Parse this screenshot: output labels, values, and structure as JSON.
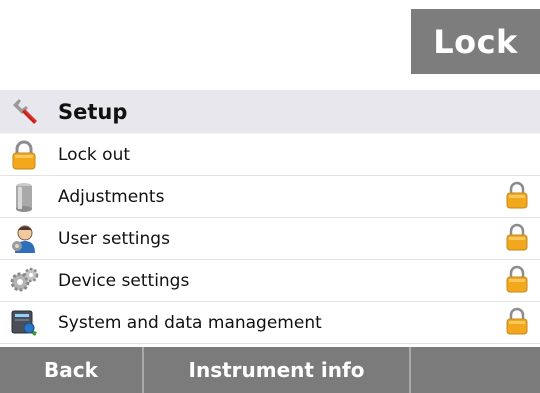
{
  "top": {
    "lock_label": "Lock"
  },
  "menu": {
    "title": "Setup",
    "title_icon": "wrench-icon",
    "items": [
      {
        "label": "Lock out",
        "icon": "padlock-icon",
        "locked": false
      },
      {
        "label": "Adjustments",
        "icon": "cylinder-weight-icon",
        "locked": true
      },
      {
        "label": "User settings",
        "icon": "user-icon",
        "locked": true
      },
      {
        "label": "Device settings",
        "icon": "gears-icon",
        "locked": true
      },
      {
        "label": "System and data management",
        "icon": "system-data-icon",
        "locked": true
      }
    ]
  },
  "footer": {
    "back_label": "Back",
    "info_label": "Instrument info"
  },
  "colors": {
    "button_gray": "#7b7b7b",
    "header_bg": "#e7e7ed",
    "lock_gold": "#f2a81d"
  }
}
